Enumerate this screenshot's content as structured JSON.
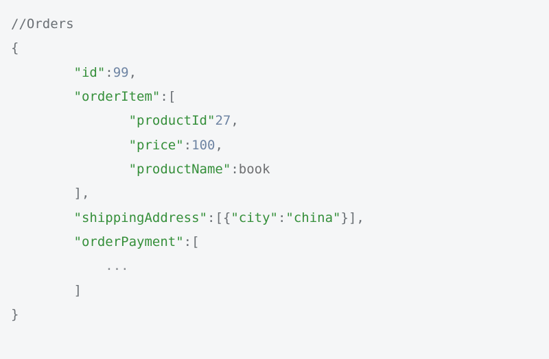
{
  "code": {
    "comment": "//Orders",
    "open_brace": "{",
    "close_brace": "}",
    "colon": ":",
    "comma": ",",
    "open_bracket": "[",
    "close_bracket": "]",
    "close_bracket_comma": "],",
    "open_obj_arr": "[{",
    "close_obj_arr": "}]",
    "keys": {
      "id": "\"id\"",
      "orderItem": "\"orderItem\"",
      "productId": "\"productId\"",
      "price": "\"price\"",
      "productName": "\"productName\"",
      "shippingAddress": "\"shippingAddress\"",
      "city": "\"city\"",
      "orderPayment": "\"orderPayment\""
    },
    "values": {
      "id": "99",
      "productId": "27",
      "price": "100",
      "productName_raw": "book",
      "china": "\"china\""
    },
    "ellipsis": "..."
  }
}
